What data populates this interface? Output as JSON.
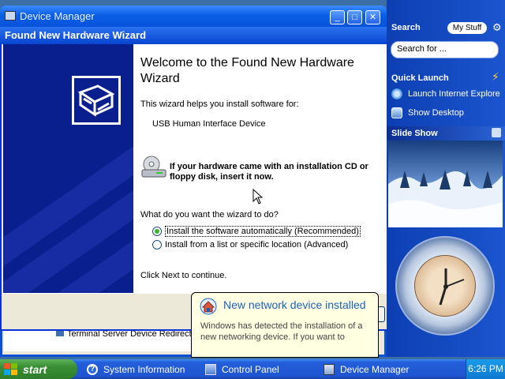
{
  "device_manager": {
    "title": "Device Manager",
    "minimize_label": "_",
    "maximize_label": "□",
    "close_label": "✕",
    "tree_item": "Terminal Server Device Redirector"
  },
  "wizard": {
    "title": "Found New Hardware Wizard",
    "heading": "Welcome to the Found New Hardware Wizard",
    "intro": "This wizard helps you install software for:",
    "device": "USB Human Interface Device",
    "cd_instruction": "If your hardware came with an installation CD or floppy disk, insert it now.",
    "question": "What do you want the wizard to do?",
    "options": [
      {
        "label": "Install the software automatically (Recommended)",
        "selected": true
      },
      {
        "label": "Install from a list or specific location (Advanced)",
        "selected": false
      }
    ],
    "continue_text": "Click Next to continue."
  },
  "balloon": {
    "title": "New network device installed",
    "body": "Windows has detected the installation of a new networking device. If you want to"
  },
  "sidebar": {
    "search_label": "Search",
    "mystuff_label": "My Stuff",
    "search_placeholder": "Search for ...",
    "quick_launch_label": "Quick Launch",
    "quick_launch_items": [
      {
        "label": "Launch Internet Explore",
        "icon": "internet-explorer-icon"
      },
      {
        "label": "Show Desktop",
        "icon": "show-desktop-icon"
      }
    ],
    "slide_show_label": "Slide Show"
  },
  "taskbar": {
    "start_label": "start",
    "tasks": [
      {
        "label": "System Information",
        "icon": "system-information-icon"
      },
      {
        "label": "Control Panel",
        "icon": "control-panel-icon"
      },
      {
        "label": "Device Manager",
        "icon": "device-manager-icon"
      }
    ],
    "clock": "6:26 PM"
  },
  "colors": {
    "xp_blue": "#245edb",
    "start_green": "#388e34",
    "wizard_banner": "#0a1f8e",
    "balloon_bg": "#ffffe1",
    "balloon_title": "#1d5fbd"
  }
}
